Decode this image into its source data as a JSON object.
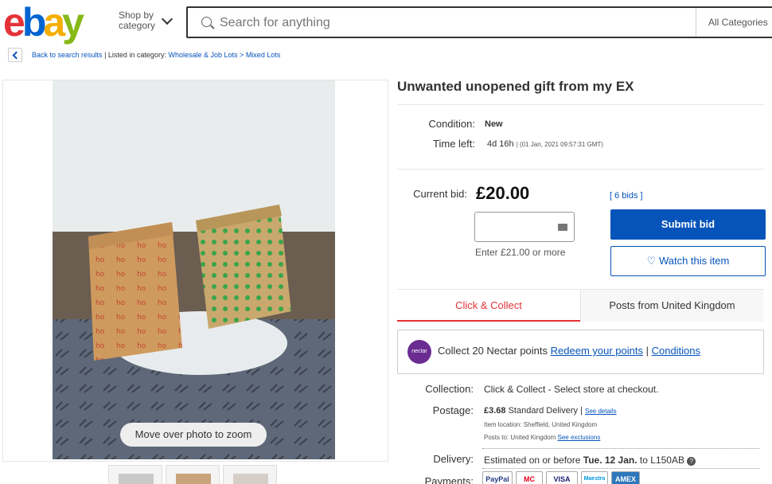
{
  "header": {
    "logo": {
      "e": "e",
      "b": "b",
      "a": "a",
      "y": "y"
    },
    "shop_by_line1": "Shop by",
    "shop_by_line2": "category",
    "search_placeholder": "Search for anything",
    "all_categories": "All Categories"
  },
  "breadcrumb": {
    "back_label": "Back to search results",
    "separator": "| Listed in category:",
    "category1": "Wholesale & Job Lots",
    "arrow": ">",
    "category2": "Mixed Lots"
  },
  "photo": {
    "zoom_hint": "Move over photo to zoom",
    "thumbnail_count": 3
  },
  "listing": {
    "title": "Unwanted unopened gift from my EX",
    "condition_label": "Condition:",
    "condition_value": "New",
    "time_left_label": "Time left:",
    "time_left_value": "4d 16h",
    "time_left_end": "| (01 Jan, 2021  09:57:31 GMT)",
    "current_bid_label": "Current bid:",
    "current_bid_value": "£20.00",
    "bids": "[ 6 bids ]",
    "bid_help": "Enter £21.00 or more",
    "submit_bid": "Submit bid",
    "watch_item": "♡ Watch this item"
  },
  "tabs": {
    "click_collect": "Click & Collect",
    "posts_from": "Posts from United Kingdom"
  },
  "nectar": {
    "logo": "nectar",
    "text": "Collect 20 Nectar points",
    "redeem": "Redeem your points",
    "sep": " | ",
    "conditions": "Conditions"
  },
  "shipping": {
    "collection_label": "Collection:",
    "collection_value": "Click & Collect - Select store at checkout.",
    "postage_label": "Postage:",
    "postage_price": "£3.68",
    "postage_type": "Standard Delivery |",
    "see_details": "See details",
    "item_location": "Item location: Sheffield, United Kingdom",
    "posts_to": "Posts to: United Kingdom",
    "see_exclusions": "See exclusions",
    "delivery_label": "Delivery:",
    "delivery_pre": "Estimated on or before",
    "delivery_date": "Tue. 12 Jan.",
    "delivery_post": "to L150AB",
    "payments_label": "Payments:",
    "payment_methods": [
      "PayPal",
      "MC",
      "VISA",
      "Maestro",
      "AMEX"
    ]
  },
  "colors": {
    "brand_red": "#e53238",
    "brand_blue": "#0064d2",
    "brand_yellow": "#f5af02",
    "brand_green": "#86b817",
    "link_blue": "#0654ba",
    "nectar_purple": "#6a2c91"
  }
}
